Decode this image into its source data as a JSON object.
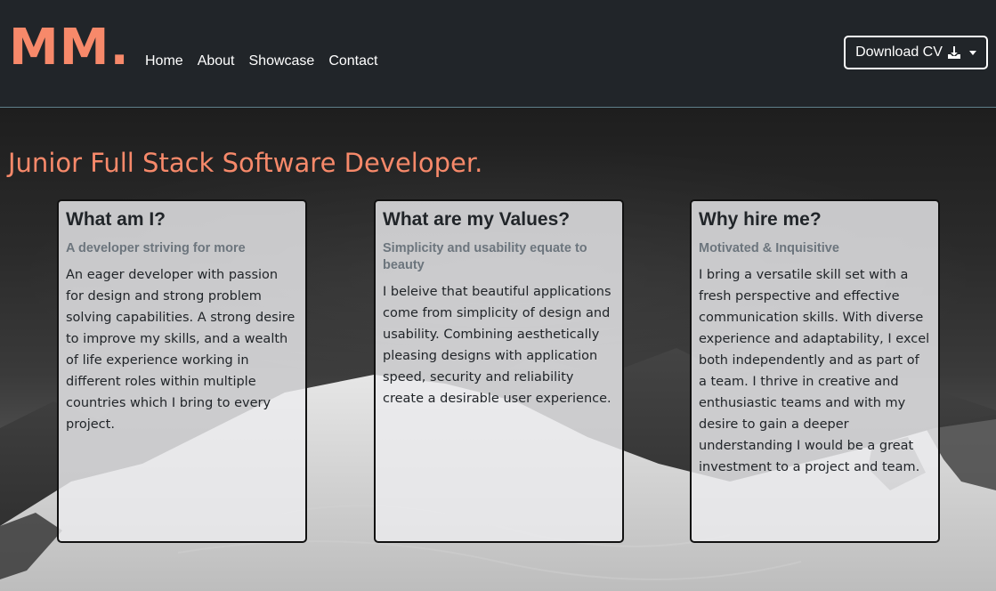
{
  "navbar": {
    "brand": "MM.",
    "links": [
      "Home",
      "About",
      "Showcase",
      "Contact"
    ],
    "cv_button": {
      "label": "Download CV",
      "icon": "download-icon"
    }
  },
  "hero": {
    "headline": "Junior Full Stack Software Developer."
  },
  "cards": [
    {
      "title": "What am I?",
      "subtitle": "A developer striving for more",
      "text": "An eager developer with passion for design and strong problem solving capabilities. A strong desire to improve my skills, and a wealth of life experience working in different roles within multiple countries which I bring to every project."
    },
    {
      "title": "What are my Values?",
      "subtitle": "Simplicity and usability equate to beauty",
      "text": "I beleive that beautiful applications come from simplicity of design and usability. Combining aesthetically pleasing designs with application speed, security and reliability create a desirable user experience."
    },
    {
      "title": "Why hire me?",
      "subtitle": "Motivated & Inquisitive",
      "text": "I bring a versatile skill set with a fresh perspective and effective communication skills. With diverse experience and adaptability, I excel both independently and as part of a team. I thrive in creative and enthusiastic teams and with my desire to gain a deeper understanding I would be a great investment to a project and team."
    }
  ],
  "colors": {
    "accent": "#f7896a",
    "navbar_bg": "#212529",
    "card_bg": "#ebeced"
  }
}
